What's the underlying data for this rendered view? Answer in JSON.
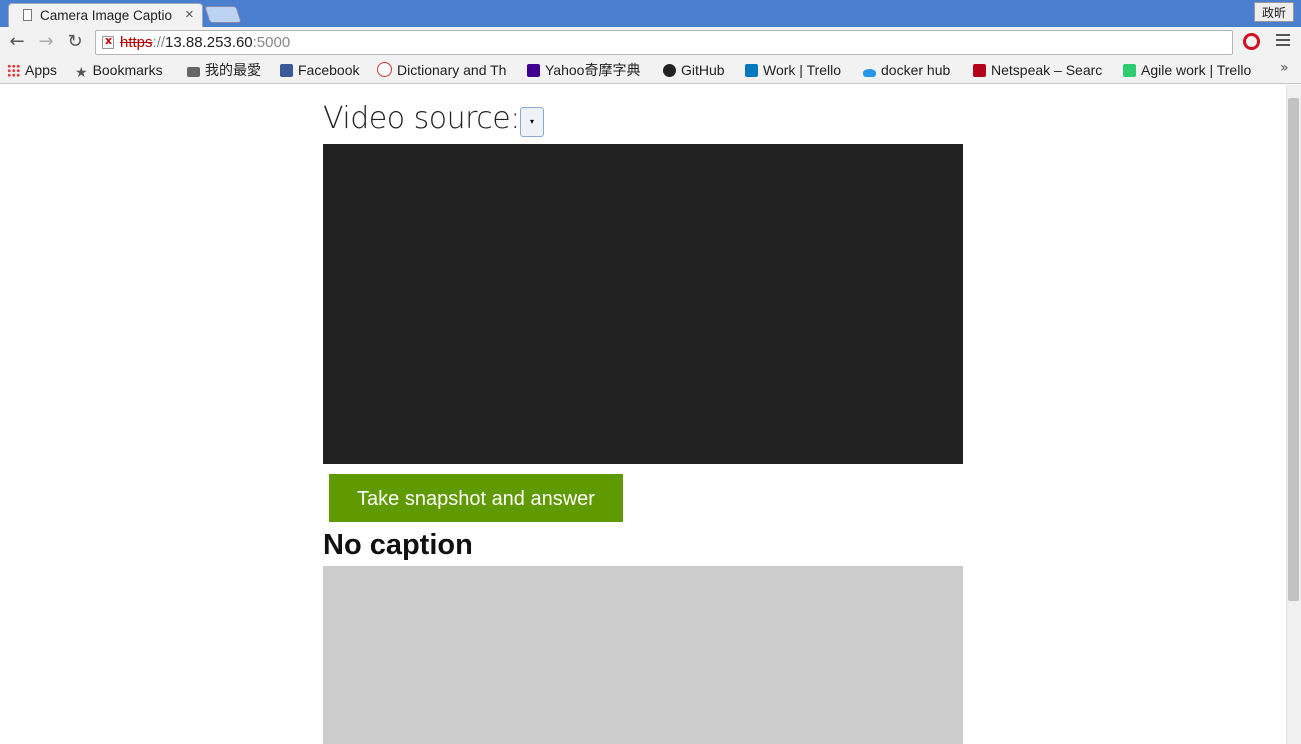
{
  "browser": {
    "tab_title": "Camera Image Captio",
    "tab_close": "×",
    "ime_label": "政昕",
    "url": {
      "scheme": "https",
      "sep": "://",
      "host": "13.88.253.60",
      "port": ":5000"
    },
    "nav": {
      "back": "←",
      "forward": "→",
      "reload": "↻"
    },
    "star": "★",
    "bookmarks": [
      {
        "label": "Apps",
        "icon": "apps-grid-icon"
      },
      {
        "label": "Bookmarks",
        "icon": "star-icon"
      },
      {
        "label": "我的最愛",
        "icon": "folder-icon"
      },
      {
        "label": "Facebook",
        "icon": "facebook-icon"
      },
      {
        "label": "Dictionary and Th",
        "icon": "merriam-webster-icon"
      },
      {
        "label": "Yahoo奇摩字典",
        "icon": "yahoo-icon"
      },
      {
        "label": "GitHub",
        "icon": "github-icon"
      },
      {
        "label": "Work | Trello",
        "icon": "trello-icon"
      },
      {
        "label": "docker hub",
        "icon": "docker-icon"
      },
      {
        "label": "Netspeak – Searc",
        "icon": "netspeak-icon"
      },
      {
        "label": "Agile work | Trello",
        "icon": "trello-green-icon"
      }
    ],
    "bookmarks_overflow": "»"
  },
  "page": {
    "video_source_label": "Video source:",
    "select_arrow": "▾",
    "snapshot_button": "Take snapshot and answer",
    "caption": "No caption"
  },
  "colors": {
    "tab_strip": "#4a7fd0",
    "video_bg": "#222222",
    "button_bg": "#5f9a00",
    "snapshot_bg": "#cccccc"
  }
}
